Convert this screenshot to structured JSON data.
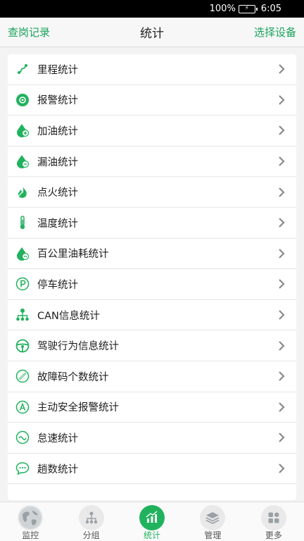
{
  "status_bar": {
    "battery": "100%",
    "time": "6:05"
  },
  "header": {
    "left": "查岗记录",
    "title": "统计",
    "right": "选择设备"
  },
  "items": [
    {
      "label": "里程统计",
      "icon": "route-icon"
    },
    {
      "label": "报警统计",
      "icon": "alarm-icon"
    },
    {
      "label": "加油统计",
      "icon": "fuel-add-icon"
    },
    {
      "label": "漏油统计",
      "icon": "fuel-leak-icon"
    },
    {
      "label": "点火统计",
      "icon": "ignition-icon"
    },
    {
      "label": "温度统计",
      "icon": "thermometer-icon"
    },
    {
      "label": "百公里油耗统计",
      "icon": "fuel-consumption-icon"
    },
    {
      "label": "停车统计",
      "icon": "parking-icon"
    },
    {
      "label": "CAN信息统计",
      "icon": "network-icon"
    },
    {
      "label": "驾驶行为信息统计",
      "icon": "steering-wheel-icon"
    },
    {
      "label": "故障码个数统计",
      "icon": "fault-code-icon"
    },
    {
      "label": "主动安全报警统计",
      "icon": "active-safety-icon"
    },
    {
      "label": "怠速统计",
      "icon": "idle-icon"
    },
    {
      "label": "趟数统计",
      "icon": "trips-icon"
    }
  ],
  "tabs": [
    {
      "label": "监控",
      "icon": "globe-icon",
      "active": false
    },
    {
      "label": "分组",
      "icon": "group-icon",
      "active": false
    },
    {
      "label": "统计",
      "icon": "chart-icon",
      "active": true
    },
    {
      "label": "管理",
      "icon": "layers-icon",
      "active": false
    },
    {
      "label": "更多",
      "icon": "more-icon",
      "active": false
    }
  ],
  "colors": {
    "accent": "#21b25e",
    "link": "#19a35b"
  }
}
